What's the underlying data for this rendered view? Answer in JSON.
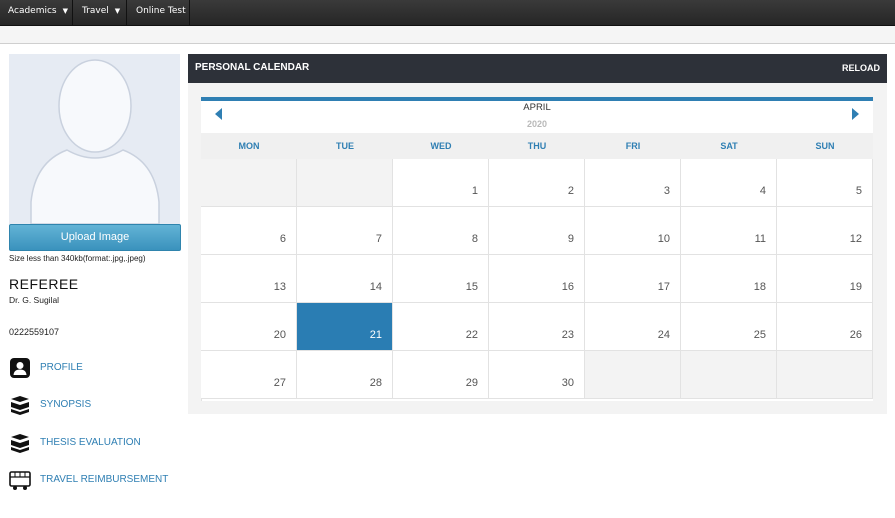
{
  "navbar": {
    "items": [
      {
        "label": "Academics",
        "has_dropdown": true
      },
      {
        "label": "Travel",
        "has_dropdown": true
      },
      {
        "label": "Online Test",
        "has_dropdown": false
      }
    ]
  },
  "profile": {
    "upload_label": "Upload Image",
    "size_note": "Size less than 340kb(format:.jpg,.jpeg)",
    "role": "REFEREE",
    "name": "Dr. G. Sugilal",
    "phone": "0222559107"
  },
  "menu": [
    {
      "label": "PROFILE",
      "icon": "profile-icon"
    },
    {
      "label": "SYNOPSIS",
      "icon": "synopsis-icon"
    },
    {
      "label": "THESIS EVALUATION",
      "icon": "thesis-icon"
    },
    {
      "label": "TRAVEL REIMBURSEMENT",
      "icon": "bus-icon"
    }
  ],
  "calendar": {
    "title": "PERSONAL CALENDAR",
    "reload_label": "RELOAD",
    "month": "APRIL",
    "year": "2020",
    "weekdays": [
      "MON",
      "TUE",
      "WED",
      "THU",
      "FRI",
      "SAT",
      "SUN"
    ],
    "weeks": [
      [
        "",
        "",
        "1",
        "2",
        "3",
        "4",
        "5"
      ],
      [
        "6",
        "7",
        "8",
        "9",
        "10",
        "11",
        "12"
      ],
      [
        "13",
        "14",
        "15",
        "16",
        "17",
        "18",
        "19"
      ],
      [
        "20",
        "21",
        "22",
        "23",
        "24",
        "25",
        "26"
      ],
      [
        "27",
        "28",
        "29",
        "30",
        "",
        "",
        ""
      ]
    ],
    "today": "21",
    "accent_color": "#2a7db3"
  },
  "colors": {
    "navbar": "#2b2b2b",
    "panel_header": "#2d3139",
    "link": "#2f7fb3"
  }
}
